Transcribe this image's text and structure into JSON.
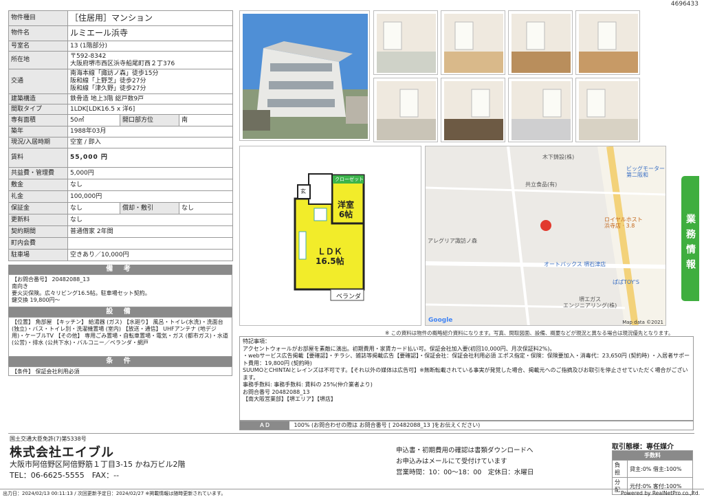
{
  "doc_id": "4696433",
  "spec": [
    {
      "label": "物件種目",
      "value": "［住居用］マンション",
      "big": true
    },
    {
      "label": "物件名",
      "value": "ルミエール浜寺",
      "big": true
    },
    {
      "label": "号室名",
      "value": "13 (1階部分)"
    },
    {
      "label": "所在地",
      "value": "〒592-8342\n大阪府堺市西区浜寺船尾町西２丁376"
    },
    {
      "label": "交通",
      "value": "南海本線「諏訪ノ森」徒歩15分\n阪和線「上野芝」徒歩27分\n阪和線「津久野」徒歩27分"
    },
    {
      "label": "建築構造",
      "value": "鉄骨造 地上3階 総戸数9戸"
    },
    {
      "label": "間取タイプ",
      "value": "1LDK[LDK16.5 x 洋6]"
    }
  ],
  "area": {
    "label": "専有面積",
    "value": "50㎡",
    "dir_label": "開口部方位",
    "dir_value": "南"
  },
  "spec2": [
    {
      "label": "築年",
      "value": "1988年03月"
    },
    {
      "label": "現況/入居時期",
      "value": "空室 / 即入"
    }
  ],
  "rent": {
    "label": "賃料",
    "value": "55,000 円"
  },
  "spec3": [
    {
      "label": "共益費・管理費",
      "value": "5,000円"
    },
    {
      "label": "敷金",
      "value": "なし"
    },
    {
      "label": "礼金",
      "value": "100,000円"
    }
  ],
  "deposit": {
    "label": "保証金",
    "value": "なし",
    "sub_label": "償却・敷引",
    "sub_value": "なし"
  },
  "spec4": [
    {
      "label": "更新料",
      "value": "なし"
    },
    {
      "label": "契約期間",
      "value": "普通借家 2年間"
    },
    {
      "label": "町内会費",
      "value": ""
    },
    {
      "label": "駐車場",
      "value": "空きあり／10,000円"
    }
  ],
  "notes_title": "備 考",
  "notes": "【お問合番号】 20482088_13\n南向き\n要火災保険。広々リビング16.5帖。駐車場セット契約。\n鍵交換 19,800円〜",
  "facilities_title": "設 備",
  "facilities": "【位置】 角部屋 【キッチン】 給湯器 (ガス) 【水廻り】 風呂・トイレ(水洗)・洗面台 (独立)・バス・トイレ別・洗濯機置場 (室内) 【放送・通信】 UHFアンテナ (地デジ用)・ケーブルTV 【その他】 専用ごみ置場・自転車置場・電気・ガス (都市ガス)・水道 (公営)・排水 (公共下水)・バルコニー／ベランダ・網戸",
  "conditions_title": "条 件",
  "conditions": "【条件】 保証会社利用必須",
  "floorplan": {
    "closet": "クローゼット",
    "entrance": "玄",
    "room": "洋室\n6帖",
    "ldk": "ＬＤＫ\n16.5帖",
    "veranda": "ベランダ"
  },
  "map": {
    "labels": [
      "木下鋳設(株)",
      "共立食品(有)",
      "アレグリア諏訪ノ森",
      "ロイヤルホスト\n浜寺店 · 3.8",
      "オートバックス 堺石津店",
      "ぱぱTOY'S",
      "堺エガス\nエンジニアリング(株)",
      "ビッグモーター\n第二阪和"
    ],
    "google": "Google",
    "attribution": "Map data ©2021"
  },
  "side_tab": "業務情報",
  "disclaimer": "※ この資料は物件の概略紹介資料になります。写真、間取図面、設備、概要などが現況と異なる場合は現況優先となります。",
  "special": "特記事項：\nアクセントウォールがお部屋を素敵に演出。初期費用・家賃カード払い可。保証会社加入要(初回10,000円、月次保証料2%)。\n・webサービス広告掲載【要確認】・チラシ、雑誌等掲載広告【要確認】・保証会社：保証会社利用必須 エポス指定・保険：保険要加入・消毒代：23,650円 (契約時) ・入居者サポート費用：19,800円 (契約時)\nSUUMOとCHINTAIとレインズは不可です。【それ以外の媒体は広告可】※無断転載されている事実が発覚した場合、掲載元へのご指摘及びお取引を停止させていただく場合がございます。\n事務手数料: 事務手数料: 賃料の 25%(仲介業者より)\nお問合番号 20482088_13\n【南大阪営業部】【堺エリア】【堺店】",
  "ad": {
    "label": "ＡＤ",
    "value": "100% (お問合わせの際は お問合番号 [ 20482088_13 ]をお伝えください)"
  },
  "company": {
    "license": "国土交通大臣免許(7)第5338号",
    "name": "株式会社エイブル",
    "address": "大阪市阿倍野区阿倍野筋１丁目3-15 かね万ビル2階",
    "tel": "TEL：06-6625-5555　FAX：--"
  },
  "contact": [
    "申込書・初期費用の確認は書類ダウンロードへ",
    "お申込みはメールにて受付けています",
    "営業時間：10：00〜18：00　定休日：水曜日"
  ],
  "fees": {
    "title": "取引態様：専任媒介",
    "header": "手数料",
    "rows": [
      {
        "k": "負担",
        "v": "貸主:0% 借主:100%"
      },
      {
        "k": "分配",
        "v": "元付:0% 客付:100%"
      }
    ]
  },
  "footer_left": "出力日：2024/02/13 00:11:13 / 次回更新予定日：2024/02/27 ※掲載情報は随時更新されています。",
  "footer_right": "Powered by RealNetPro co.,ltd."
}
